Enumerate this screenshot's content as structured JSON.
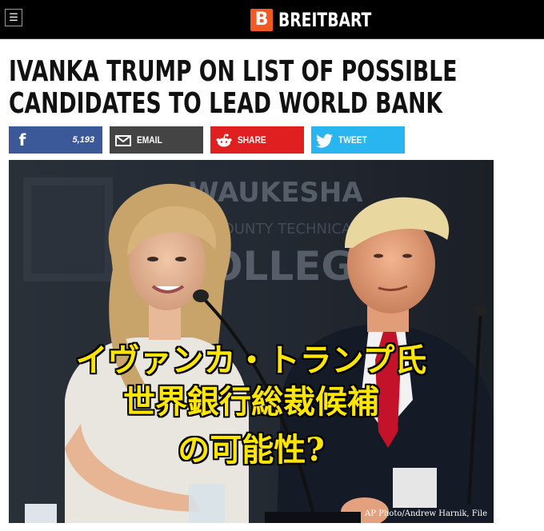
{
  "header": {
    "menu_icon": "hamburger-icon",
    "brand_letter": "B",
    "brand_name": "BREITBART"
  },
  "article": {
    "headline_line1": "IVANKA TRUMP ON LIST OF POSSIBLE",
    "headline_line2": "CANDIDATES TO LEAD WORLD BANK"
  },
  "share": {
    "facebook": {
      "icon": "facebook-icon",
      "count": "5,193",
      "color": "#3b5998"
    },
    "email": {
      "icon": "envelope-icon",
      "label": "EMAIL",
      "color": "#444444"
    },
    "reddit": {
      "icon": "reddit-icon",
      "label": "SHARE",
      "color": "#e02020"
    },
    "twitter": {
      "icon": "twitter-bird-icon",
      "label": "TWEET",
      "color": "#29b6f0"
    }
  },
  "photo": {
    "overlay_line1": "イヴァンカ・トランプ氏",
    "overlay_line2": "世界銀行総裁候補",
    "overlay_line3": "の可能性?",
    "overlay_color": "#ffe600",
    "credit": "AP Photo/Andrew Harnik, File"
  },
  "colors": {
    "brand_orange": "#f15a24",
    "topbar": "#000000"
  }
}
